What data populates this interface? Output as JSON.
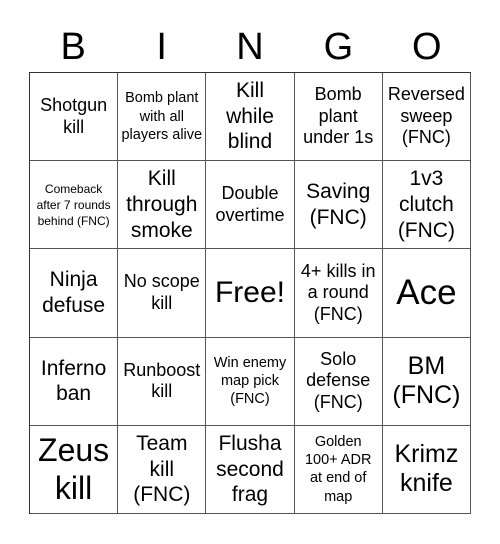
{
  "header": {
    "letters": [
      "B",
      "I",
      "N",
      "G",
      "O"
    ]
  },
  "cells": [
    [
      "Shotgun kill",
      "Bomb plant with all players alive",
      "Kill while blind",
      "Bomb plant under 1s",
      "Reversed sweep (FNC)"
    ],
    [
      "Comeback after 7 rounds behind (FNC)",
      "Kill through smoke",
      "Double overtime",
      "Saving (FNC)",
      "1v3 clutch (FNC)"
    ],
    [
      "Ninja defuse",
      "No scope kill",
      "Free!",
      "4+ kills in a round (FNC)",
      "Ace"
    ],
    [
      "Inferno ban",
      "Runboost kill",
      "Win enemy map pick (FNC)",
      "Solo defense (FNC)",
      "BM (FNC)"
    ],
    [
      "Zeus kill",
      "Team kill (FNC)",
      "Flusha second frag",
      "Golden 100+ ADR at end of map",
      "Krimz knife"
    ]
  ]
}
